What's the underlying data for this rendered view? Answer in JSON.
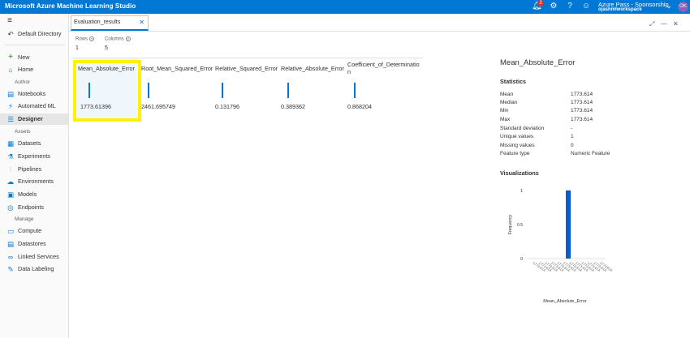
{
  "header": {
    "app_title": "Microsoft Azure Machine Learning Studio",
    "notification_count": "2",
    "account_name": "Azure Pass - Sponsorship",
    "workspace": "ojashmlworkspace",
    "avatar_initials": "OK"
  },
  "sidebar": {
    "directory": "Default Directory",
    "items_top": [
      {
        "label": "New",
        "icon": "plus-icon"
      },
      {
        "label": "Home",
        "icon": "home-icon"
      }
    ],
    "author_label": "Author",
    "items_author": [
      {
        "label": "Notebooks",
        "icon": "notebook-icon"
      },
      {
        "label": "Automated ML",
        "icon": "lightning-icon"
      },
      {
        "label": "Designer",
        "icon": "designer-icon"
      }
    ],
    "assets_label": "Assets",
    "items_assets": [
      {
        "label": "Datasets",
        "icon": "database-icon"
      },
      {
        "label": "Experiments",
        "icon": "flask-icon"
      },
      {
        "label": "Pipelines",
        "icon": "pipeline-icon"
      },
      {
        "label": "Environments",
        "icon": "cloud-icon"
      },
      {
        "label": "Models",
        "icon": "cube-icon"
      },
      {
        "label": "Endpoints",
        "icon": "endpoint-icon"
      }
    ],
    "manage_label": "Manage",
    "items_manage": [
      {
        "label": "Compute",
        "icon": "compute-icon"
      },
      {
        "label": "Datastores",
        "icon": "storage-icon"
      },
      {
        "label": "Linked Services",
        "icon": "link-icon"
      },
      {
        "label": "Data Labeling",
        "icon": "tag-icon"
      }
    ]
  },
  "tab": {
    "label": "Evaluation_results"
  },
  "summary": {
    "rows_label": "Rows",
    "rows_value": "1",
    "columns_label": "Columns",
    "columns_value": "5"
  },
  "table": {
    "columns": [
      {
        "header": "Mean_Absolute_Error",
        "value": "1773.61396"
      },
      {
        "header": "Root_Mean_Squared_Error",
        "value": "2461.695749"
      },
      {
        "header": "Relative_Squared_Error",
        "value": "0.131796"
      },
      {
        "header": "Relative_Absolute_Error",
        "value": "0.389362"
      },
      {
        "header": "Coefficient_of_Determination",
        "value": "0.868204"
      }
    ]
  },
  "details": {
    "title": "Mean_Absolute_Error",
    "statistics_label": "Statistics",
    "stats": [
      {
        "key": "Mean",
        "value": "1773.614"
      },
      {
        "key": "Median",
        "value": "1773.614"
      },
      {
        "key": "Min",
        "value": "1773.614"
      },
      {
        "key": "Max",
        "value": "1773.614"
      },
      {
        "key": "Standard deviation",
        "value": "-"
      },
      {
        "key": "Unique values",
        "value": "1"
      },
      {
        "key": "Missing values",
        "value": "0"
      },
      {
        "key": "Feature type",
        "value": "Numeric Feature"
      }
    ],
    "visualizations_label": "Visualizations"
  },
  "chart_data": {
    "type": "bar",
    "categories": [
      "1773.614"
    ],
    "values": [
      1
    ],
    "ylabel": "Frequency",
    "xlabel": "Mean_Absolute_Error",
    "yticks": [
      "0",
      "0.5",
      "1"
    ],
    "ylim": [
      0,
      1
    ],
    "bar_color": "#0b5cd1"
  },
  "colors": {
    "accent": "#0078d4",
    "highlight": "#fff200"
  }
}
